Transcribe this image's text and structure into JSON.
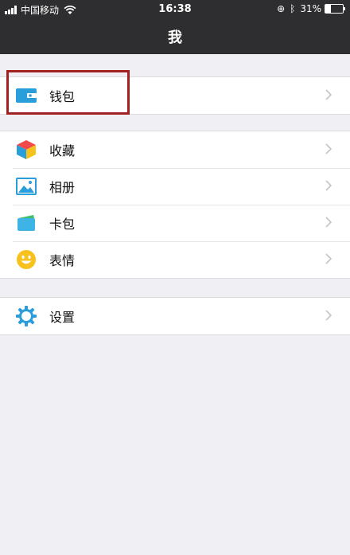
{
  "status_bar": {
    "carrier": "中国移动",
    "time": "16:38",
    "battery_percent": "31%",
    "battery_level": 0.31
  },
  "nav": {
    "title": "我"
  },
  "groups": [
    {
      "items": [
        {
          "label": "钱包",
          "icon": "wallet-icon"
        }
      ]
    },
    {
      "items": [
        {
          "label": "收藏",
          "icon": "favorites-cube-icon"
        },
        {
          "label": "相册",
          "icon": "album-icon"
        },
        {
          "label": "卡包",
          "icon": "card-pack-icon"
        },
        {
          "label": "表情",
          "icon": "smiley-icon"
        }
      ]
    },
    {
      "items": [
        {
          "label": "设置",
          "icon": "settings-gear-icon"
        }
      ]
    }
  ],
  "colors": {
    "header_bg": "#2e2e31",
    "page_bg": "#efeff4",
    "highlight": "#a32020",
    "wallet_blue": "#2a9ddb",
    "smiley_yellow": "#f7c21c"
  }
}
